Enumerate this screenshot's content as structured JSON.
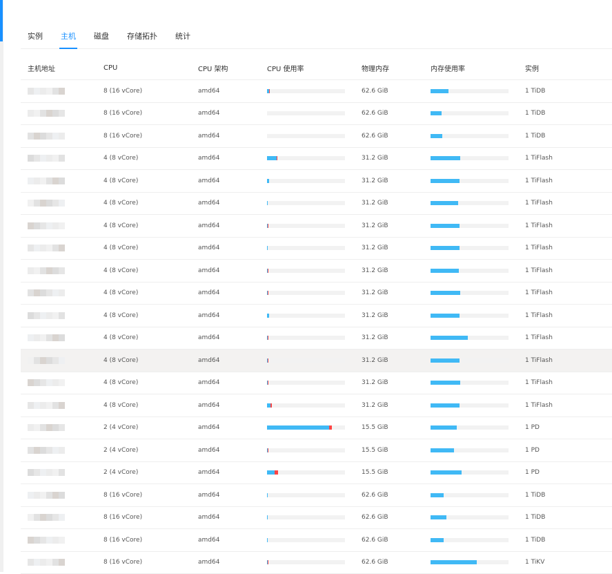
{
  "tabs": [
    {
      "label": "实例"
    },
    {
      "label": "主机",
      "active": true
    },
    {
      "label": "磁盘"
    },
    {
      "label": "存储拓扑"
    },
    {
      "label": "统计"
    }
  ],
  "columns": [
    "主机地址",
    "CPU",
    "CPU 架构",
    "CPU 使用率",
    "物理内存",
    "内存使用率",
    "实例"
  ],
  "colors": {
    "accent": "#1890ff",
    "bar_blue": "#40b9f5",
    "bar_red": "#ff4444"
  },
  "rows": [
    {
      "cpu": "8 (16 vCore)",
      "arch": "amd64",
      "cpu_user": 0.027,
      "cpu_sys": 0.009,
      "mem": "62.6 GiB",
      "mem_usage": 0.23,
      "inst": "1 TiDB"
    },
    {
      "cpu": "8 (16 vCore)",
      "arch": "amd64",
      "cpu_user": 0,
      "cpu_sys": 0,
      "mem": "62.6 GiB",
      "mem_usage": 0.14,
      "inst": "1 TiDB"
    },
    {
      "cpu": "8 (16 vCore)",
      "arch": "amd64",
      "cpu_user": 0,
      "cpu_sys": 0,
      "mem": "62.6 GiB",
      "mem_usage": 0.15,
      "inst": "1 TiDB"
    },
    {
      "cpu": "4 (8 vCore)",
      "arch": "amd64",
      "cpu_user": 0.12,
      "cpu_sys": 0.01,
      "mem": "31.2 GiB",
      "mem_usage": 0.38,
      "inst": "1 TiFlash"
    },
    {
      "cpu": "4 (8 vCore)",
      "arch": "amd64",
      "cpu_user": 0.027,
      "cpu_sys": 0,
      "mem": "31.2 GiB",
      "mem_usage": 0.37,
      "inst": "1 TiFlash"
    },
    {
      "cpu": "4 (8 vCore)",
      "arch": "amd64",
      "cpu_user": 0.009,
      "cpu_sys": 0,
      "mem": "31.2 GiB",
      "mem_usage": 0.35,
      "inst": "1 TiFlash"
    },
    {
      "cpu": "4 (8 vCore)",
      "arch": "amd64",
      "cpu_user": 0.005,
      "cpu_sys": 0.013,
      "mem": "31.2 GiB",
      "mem_usage": 0.37,
      "inst": "1 TiFlash"
    },
    {
      "cpu": "4 (8 vCore)",
      "arch": "amd64",
      "cpu_user": 0.009,
      "cpu_sys": 0,
      "mem": "31.2 GiB",
      "mem_usage": 0.37,
      "inst": "1 TiFlash"
    },
    {
      "cpu": "4 (8 vCore)",
      "arch": "amd64",
      "cpu_user": 0.005,
      "cpu_sys": 0.013,
      "mem": "31.2 GiB",
      "mem_usage": 0.36,
      "inst": "1 TiFlash"
    },
    {
      "cpu": "4 (8 vCore)",
      "arch": "amd64",
      "cpu_user": 0.005,
      "cpu_sys": 0.013,
      "mem": "31.2 GiB",
      "mem_usage": 0.38,
      "inst": "1 TiFlash"
    },
    {
      "cpu": "4 (8 vCore)",
      "arch": "amd64",
      "cpu_user": 0.027,
      "cpu_sys": 0,
      "mem": "31.2 GiB",
      "mem_usage": 0.37,
      "inst": "1 TiFlash"
    },
    {
      "cpu": "4 (8 vCore)",
      "arch": "amd64",
      "cpu_user": 0.005,
      "cpu_sys": 0.013,
      "mem": "31.2 GiB",
      "mem_usage": 0.48,
      "inst": "1 TiFlash"
    },
    {
      "cpu": "4 (8 vCore)",
      "arch": "amd64",
      "cpu_user": 0.005,
      "cpu_sys": 0.013,
      "mem": "31.2 GiB",
      "mem_usage": 0.37,
      "inst": "1 TiFlash",
      "hover": true
    },
    {
      "cpu": "4 (8 vCore)",
      "arch": "amd64",
      "cpu_user": 0.005,
      "cpu_sys": 0.013,
      "mem": "31.2 GiB",
      "mem_usage": 0.38,
      "inst": "1 TiFlash"
    },
    {
      "cpu": "4 (8 vCore)",
      "arch": "amd64",
      "cpu_user": 0.044,
      "cpu_sys": 0.018,
      "mem": "31.2 GiB",
      "mem_usage": 0.37,
      "inst": "1 TiFlash"
    },
    {
      "cpu": "2 (4 vCore)",
      "arch": "amd64",
      "cpu_user": 0.8,
      "cpu_sys": 0.035,
      "mem": "15.5 GiB",
      "mem_usage": 0.34,
      "inst": "1 PD"
    },
    {
      "cpu": "2 (4 vCore)",
      "arch": "amd64",
      "cpu_user": 0.005,
      "cpu_sys": 0.013,
      "mem": "15.5 GiB",
      "mem_usage": 0.3,
      "inst": "1 PD"
    },
    {
      "cpu": "2 (4 vCore)",
      "arch": "amd64",
      "cpu_user": 0.097,
      "cpu_sys": 0.044,
      "mem": "15.5 GiB",
      "mem_usage": 0.4,
      "inst": "1 PD"
    },
    {
      "cpu": "8 (16 vCore)",
      "arch": "amd64",
      "cpu_user": 0.009,
      "cpu_sys": 0,
      "mem": "62.6 GiB",
      "mem_usage": 0.17,
      "inst": "1 TiDB"
    },
    {
      "cpu": "8 (16 vCore)",
      "arch": "amd64",
      "cpu_user": 0.009,
      "cpu_sys": 0,
      "mem": "62.6 GiB",
      "mem_usage": 0.2,
      "inst": "1 TiDB"
    },
    {
      "cpu": "8 (16 vCore)",
      "arch": "amd64",
      "cpu_user": 0.009,
      "cpu_sys": 0,
      "mem": "62.6 GiB",
      "mem_usage": 0.17,
      "inst": "1 TiDB"
    },
    {
      "cpu": "8 (16 vCore)",
      "arch": "amd64",
      "cpu_user": 0.005,
      "cpu_sys": 0.013,
      "mem": "62.6 GiB",
      "mem_usage": 0.59,
      "inst": "1 TiKV"
    }
  ]
}
